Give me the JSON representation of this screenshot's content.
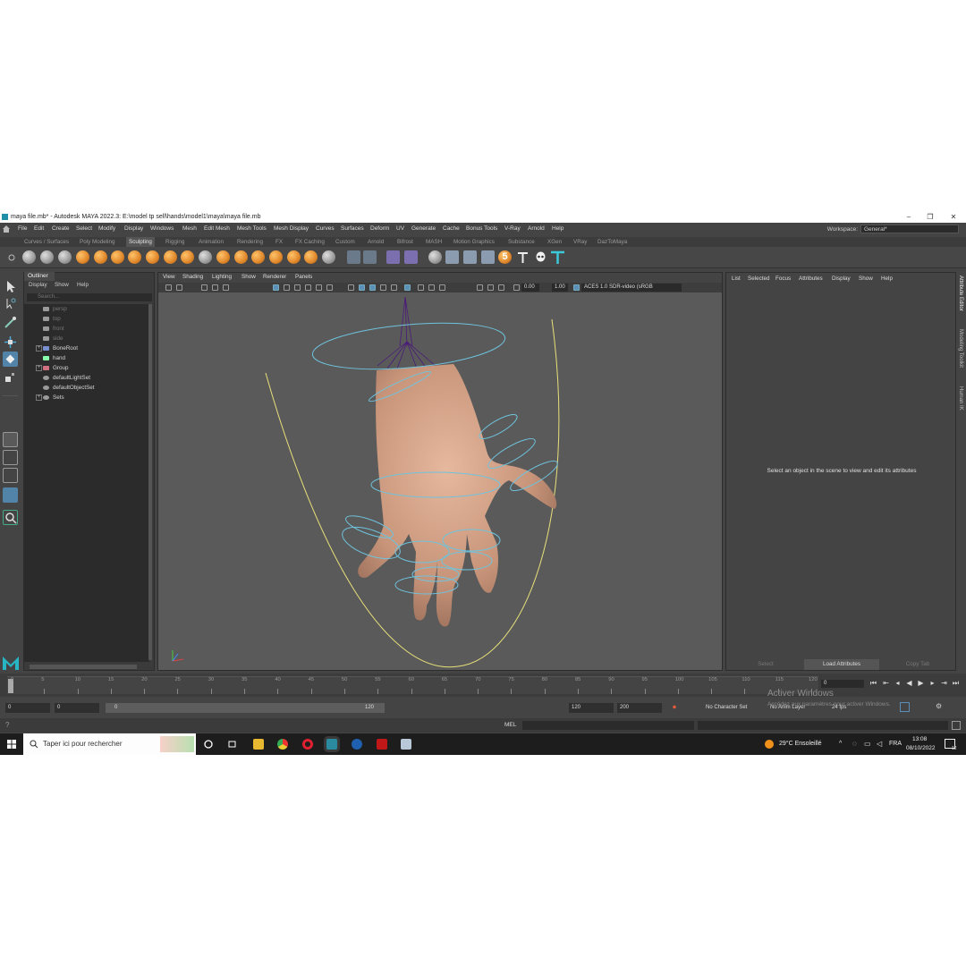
{
  "window": {
    "title": "maya file.mb* - Autodesk MAYA 2022.3: E:\\model tp sell\\hands\\model1\\maya\\maya file.mb",
    "controls": [
      "–",
      "❐",
      "✕"
    ]
  },
  "menubar": {
    "items": [
      "File",
      "Edit",
      "Create",
      "Select",
      "Modify",
      "Display",
      "Windows",
      "Mesh",
      "Edit Mesh",
      "Mesh Tools",
      "Mesh Display",
      "Curves",
      "Surfaces",
      "Deform",
      "UV",
      "Generate",
      "Cache",
      "Bonus Tools",
      "V-Ray",
      "Arnold",
      "Help"
    ],
    "workspace_label": "Workspace:",
    "workspace_value": "General*"
  },
  "shelf": {
    "tabs": [
      "Curves / Surfaces",
      "Poly Modeling",
      "Sculpting",
      "Rigging",
      "Animation",
      "Rendering",
      "FX",
      "FX Caching",
      "Custom",
      "Arnold",
      "Bifrost",
      "MASH",
      "Motion Graphics",
      "Substance",
      "XGen",
      "VRay",
      "DazToMaya"
    ],
    "active_tab": "Sculpting",
    "badge_number": "5"
  },
  "outliner": {
    "title": "Outliner",
    "menus": [
      "Display",
      "Show",
      "Help"
    ],
    "search_placeholder": "Search...",
    "items": [
      {
        "label": "persp",
        "dim": true,
        "icon": "camera-icon"
      },
      {
        "label": "top",
        "dim": true,
        "icon": "camera-icon"
      },
      {
        "label": "front",
        "dim": true,
        "icon": "camera-icon"
      },
      {
        "label": "side",
        "dim": true,
        "icon": "camera-icon"
      },
      {
        "label": "BoneRoot",
        "dim": false,
        "icon": "joint-icon",
        "expand": true
      },
      {
        "label": "hand",
        "dim": false,
        "icon": "mesh-icon"
      },
      {
        "label": "Group",
        "dim": false,
        "icon": "group-icon",
        "expand": true
      },
      {
        "label": "defaultLightSet",
        "dim": false,
        "icon": "set-icon"
      },
      {
        "label": "defaultObjectSet",
        "dim": false,
        "icon": "set-icon"
      },
      {
        "label": "Sets",
        "dim": false,
        "icon": "set-icon",
        "expand": true
      }
    ]
  },
  "viewport": {
    "menus": [
      "View",
      "Shading",
      "Lighting",
      "Show",
      "Renderer",
      "Panels"
    ],
    "exposure": "0.00",
    "gamma": "1.00",
    "color_space": "ACES 1.0 SDR-video (sRGB"
  },
  "attribute_editor": {
    "menus": [
      "List",
      "Selected",
      "Focus",
      "Attributes",
      "Display",
      "Show",
      "Help"
    ],
    "message": "Select an object in the scene to view and edit its attributes",
    "buttons": [
      "Select",
      "Load Attributes",
      "Copy Tab"
    ]
  },
  "side_tabs": [
    "Attribute Editor",
    "Modeling Toolkit",
    "Human IK"
  ],
  "timeline": {
    "ticks": [
      "5",
      "10",
      "15",
      "20",
      "25",
      "30",
      "35",
      "40",
      "45",
      "50",
      "55",
      "60",
      "65",
      "70",
      "75",
      "80",
      "85",
      "90",
      "95",
      "100",
      "105",
      "110",
      "115",
      "120"
    ],
    "start_tick": "0",
    "current_frame": "0"
  },
  "range": {
    "start_time": "0",
    "playback_start": "0",
    "slider_start": "0",
    "slider_end": "120",
    "playback_end": "120",
    "end_time": "200",
    "character_set": "No Character Set",
    "anim_layer": "No Anim Layer",
    "fps": "24 fps"
  },
  "windows_watermark": {
    "line1": "Activer Windows",
    "line2": "Accédez aux paramètres pour activer Windows."
  },
  "command_line": {
    "label": "MEL"
  },
  "taskbar": {
    "search_placeholder": "Taper ici pour rechercher",
    "weather": "29°C  Ensoleillé",
    "language": "FRA",
    "time": "13:08",
    "date": "08/10/2022",
    "notification_count": "12"
  },
  "colors": {
    "accent": "#5283a8",
    "shelf_icon": "#e0872a",
    "curve_yellow": "#e8e07a",
    "control_blue": "#6fc3dd",
    "bones_purple": "#4a1a7a"
  }
}
